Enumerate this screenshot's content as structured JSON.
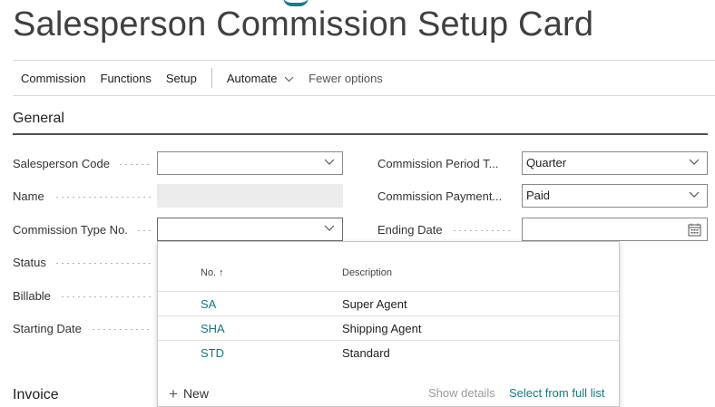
{
  "page": {
    "title": "Salesperson Commission Setup Card"
  },
  "actions": {
    "commission": "Commission",
    "functions": "Functions",
    "setup": "Setup",
    "automate": "Automate",
    "fewer_options": "Fewer options"
  },
  "sections": {
    "general": "General",
    "invoice": "Invoice"
  },
  "fields": {
    "salesperson_code": {
      "label": "Salesperson Code",
      "value": ""
    },
    "name": {
      "label": "Name",
      "value": ""
    },
    "commission_type_no": {
      "label": "Commission Type No.",
      "value": ""
    },
    "status": {
      "label": "Status"
    },
    "billable": {
      "label": "Billable"
    },
    "starting_date": {
      "label": "Starting Date"
    },
    "commission_period": {
      "label": "Commission Period T...",
      "value": "Quarter"
    },
    "commission_payment": {
      "label": "Commission Payment...",
      "value": "Paid"
    },
    "ending_date": {
      "label": "Ending Date",
      "value": ""
    }
  },
  "lookup": {
    "col_no": "No. ↑",
    "col_description": "Description",
    "rows": [
      {
        "no": "SA",
        "description": "Super Agent"
      },
      {
        "no": "SHA",
        "description": "Shipping Agent"
      },
      {
        "no": "STD",
        "description": "Standard"
      }
    ],
    "new_label": "New",
    "show_details": "Show details",
    "select_full_list": "Select from full list"
  },
  "colors": {
    "accent": "#117a82",
    "text": "#212121"
  },
  "icons": [
    "chevron-down-icon",
    "calendar-icon",
    "plus-icon",
    "sort-up-icon"
  ]
}
